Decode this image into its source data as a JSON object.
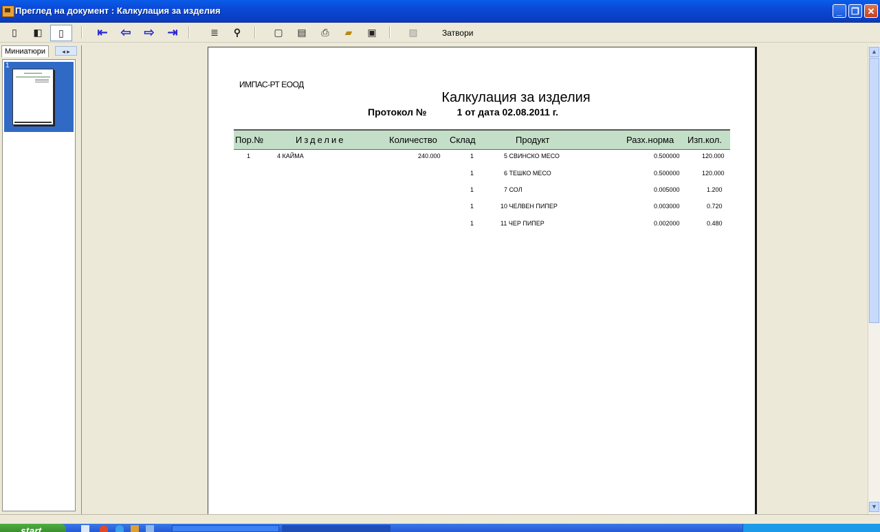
{
  "window": {
    "title": "Преглед на документ : Калкулация за изделия",
    "minimize_symbol": "_",
    "restore_symbol": "❐",
    "close_symbol": "✕"
  },
  "toolbar": {
    "close_label": "Затвори",
    "icons": [
      "single-page-icon",
      "two-page-icon",
      "full-page-icon",
      "first-page-icon",
      "previous-page-icon",
      "next-page-icon",
      "last-page-icon",
      "go-to-page-icon",
      "find-icon",
      "page-setup-icon",
      "print-setup-icon",
      "print-icon",
      "open-icon",
      "save-icon",
      "export-icon"
    ]
  },
  "left_panel": {
    "tab_label": "Миниатюри",
    "tab_arrows": "◂ ▸",
    "thumbnail_number": "1"
  },
  "report": {
    "company": "ИМПАС-РТ ЕООД",
    "title": "Калкулация за изделия",
    "protocol_label": "Протокол №",
    "protocol_number": "1",
    "protocol_date": "от дата 02.08.2011 г.",
    "columns": [
      "Пор.№",
      "Изделие",
      "Количество",
      "Склад",
      "Продукт",
      "Разх.норма",
      "Изп.кол."
    ],
    "rows": [
      {
        "no": "1",
        "product_item": "4 КАЙМА",
        "qty": "240.000",
        "store": "1",
        "ingredient": "5 СВИНСКО МЕСО",
        "norm": "0.500000",
        "used": "120.000"
      },
      {
        "no": "",
        "product_item": "",
        "qty": "",
        "store": "1",
        "ingredient": "6 ТЕШКО МЕСО",
        "norm": "0.500000",
        "used": "120.000"
      },
      {
        "no": "",
        "product_item": "",
        "qty": "",
        "store": "1",
        "ingredient": "7 СОЛ",
        "norm": "0.005000",
        "used": "1.200"
      },
      {
        "no": "",
        "product_item": "",
        "qty": "",
        "store": "1",
        "ingredient": "10 ЧЕЛВЕН ПИПЕР",
        "norm": "0.003000",
        "used": "0.720"
      },
      {
        "no": "",
        "product_item": "",
        "qty": "",
        "store": "1",
        "ingredient": "11 ЧЕР ПИПЕР",
        "norm": "0.002000",
        "used": "0.480"
      }
    ]
  },
  "taskbar": {
    "start_label": "start"
  },
  "colors": {
    "title_bar": "#0a49d6",
    "table_header": "#c4dfc8",
    "selection": "#316ac5",
    "nav_arrows": "#2a2ad6"
  }
}
